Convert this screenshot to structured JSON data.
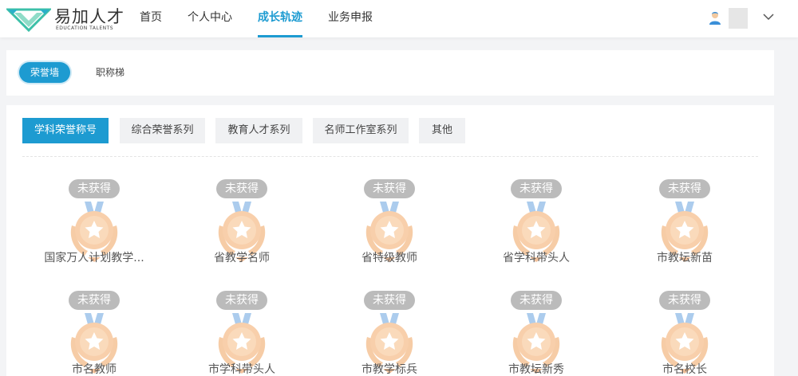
{
  "logo": {
    "name_cn": "易加人才",
    "name_en": "EDUCATION   TALENTS"
  },
  "nav": [
    {
      "label": "首页",
      "active": false
    },
    {
      "label": "个人中心",
      "active": false
    },
    {
      "label": "成长轨迹",
      "active": true
    },
    {
      "label": "业务申报",
      "active": false
    }
  ],
  "user": {
    "avatar_icon": "user-avatar-icon",
    "menu_icon": "chevron-down-icon"
  },
  "sub_tabs": [
    {
      "label": "荣誉墙",
      "active": true
    },
    {
      "label": "职称梯",
      "active": false
    }
  ],
  "categories": [
    {
      "label": "学科荣誉称号",
      "active": true
    },
    {
      "label": "综合荣誉系列",
      "active": false
    },
    {
      "label": "教育人才系列",
      "active": false
    },
    {
      "label": "名师工作室系列",
      "active": false
    },
    {
      "label": "其他",
      "active": false
    }
  ],
  "honor_status": "未获得",
  "honors": [
    {
      "name": "国家万人计划教学..."
    },
    {
      "name": "省教学名师"
    },
    {
      "name": "省特级教师"
    },
    {
      "name": "省学科带头人"
    },
    {
      "name": "市教坛新苗"
    },
    {
      "name": "市名教师"
    },
    {
      "name": "市学科带头人"
    },
    {
      "name": "市教学标兵"
    },
    {
      "name": "市教坛新秀"
    },
    {
      "name": "市名校长"
    }
  ],
  "colors": {
    "accent": "#1d9bd1",
    "medal": "#f0a35e",
    "ribbon": "#6aa3e0",
    "badge": "#969696"
  }
}
